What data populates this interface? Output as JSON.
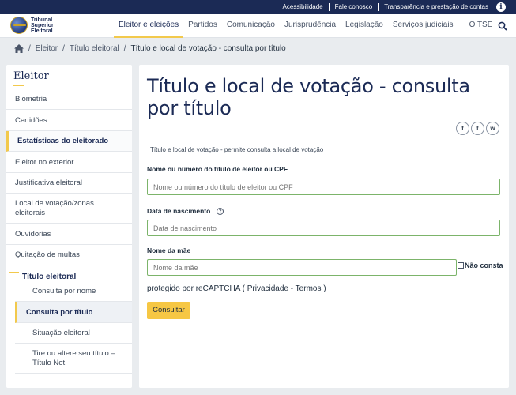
{
  "topbar": {
    "links": [
      "Acessibilidade",
      "Fale conosco",
      "Transparência e prestação de contas"
    ],
    "info_icon": "info-icon"
  },
  "logo": {
    "line1": "Tribunal",
    "line2": "Superior",
    "line3": "Eleitoral"
  },
  "nav": {
    "items": [
      "Eleitor e eleições",
      "Partidos",
      "Comunicação",
      "Jurisprudência",
      "Legislação",
      "Serviços judiciais",
      "O TSE"
    ],
    "active_index": 0,
    "search_icon": "search-icon"
  },
  "breadcrumb": {
    "items": [
      "Eleitor",
      "Título eleitoral",
      "Título e local de votação - consulta por título"
    ]
  },
  "sidebar": {
    "title": "Eleitor",
    "items": [
      "Biometria",
      "Certidões",
      "Estatísticas do eleitorado",
      "Eleitor no exterior",
      "Justificativa eleitoral",
      "Local de votação/zonas eleitorais",
      "Ouvidorias",
      "Quitação de multas"
    ],
    "group_title": "Título eleitoral",
    "subitems": [
      "Consulta por nome",
      "Consulta por título",
      "Situação eleitoral",
      "Tire ou altere seu título – Título Net"
    ]
  },
  "main": {
    "title": "Título e local de votação - consulta por título",
    "share": [
      "f",
      "t",
      "w"
    ],
    "description": "Título e local de votação - permite consulta a local de votação",
    "field1_label": "Nome ou número do título de eleitor ou CPF",
    "field1_placeholder": "Nome ou número do título de eleitor ou CPF",
    "field2_label": "Data de nascimento",
    "field2_placeholder": "Data de nascimento",
    "field3_label": "Nome da mãe",
    "field3_placeholder": "Nome da mãe",
    "checkbox_label": "Não consta",
    "recaptcha": "protegido por reCAPTCHA ( Privacidade - Termos )",
    "submit_label": "Consultar"
  },
  "colors": {
    "navy": "#1b2a55",
    "accent": "#f2c94c",
    "field_border": "#7cb46a"
  }
}
